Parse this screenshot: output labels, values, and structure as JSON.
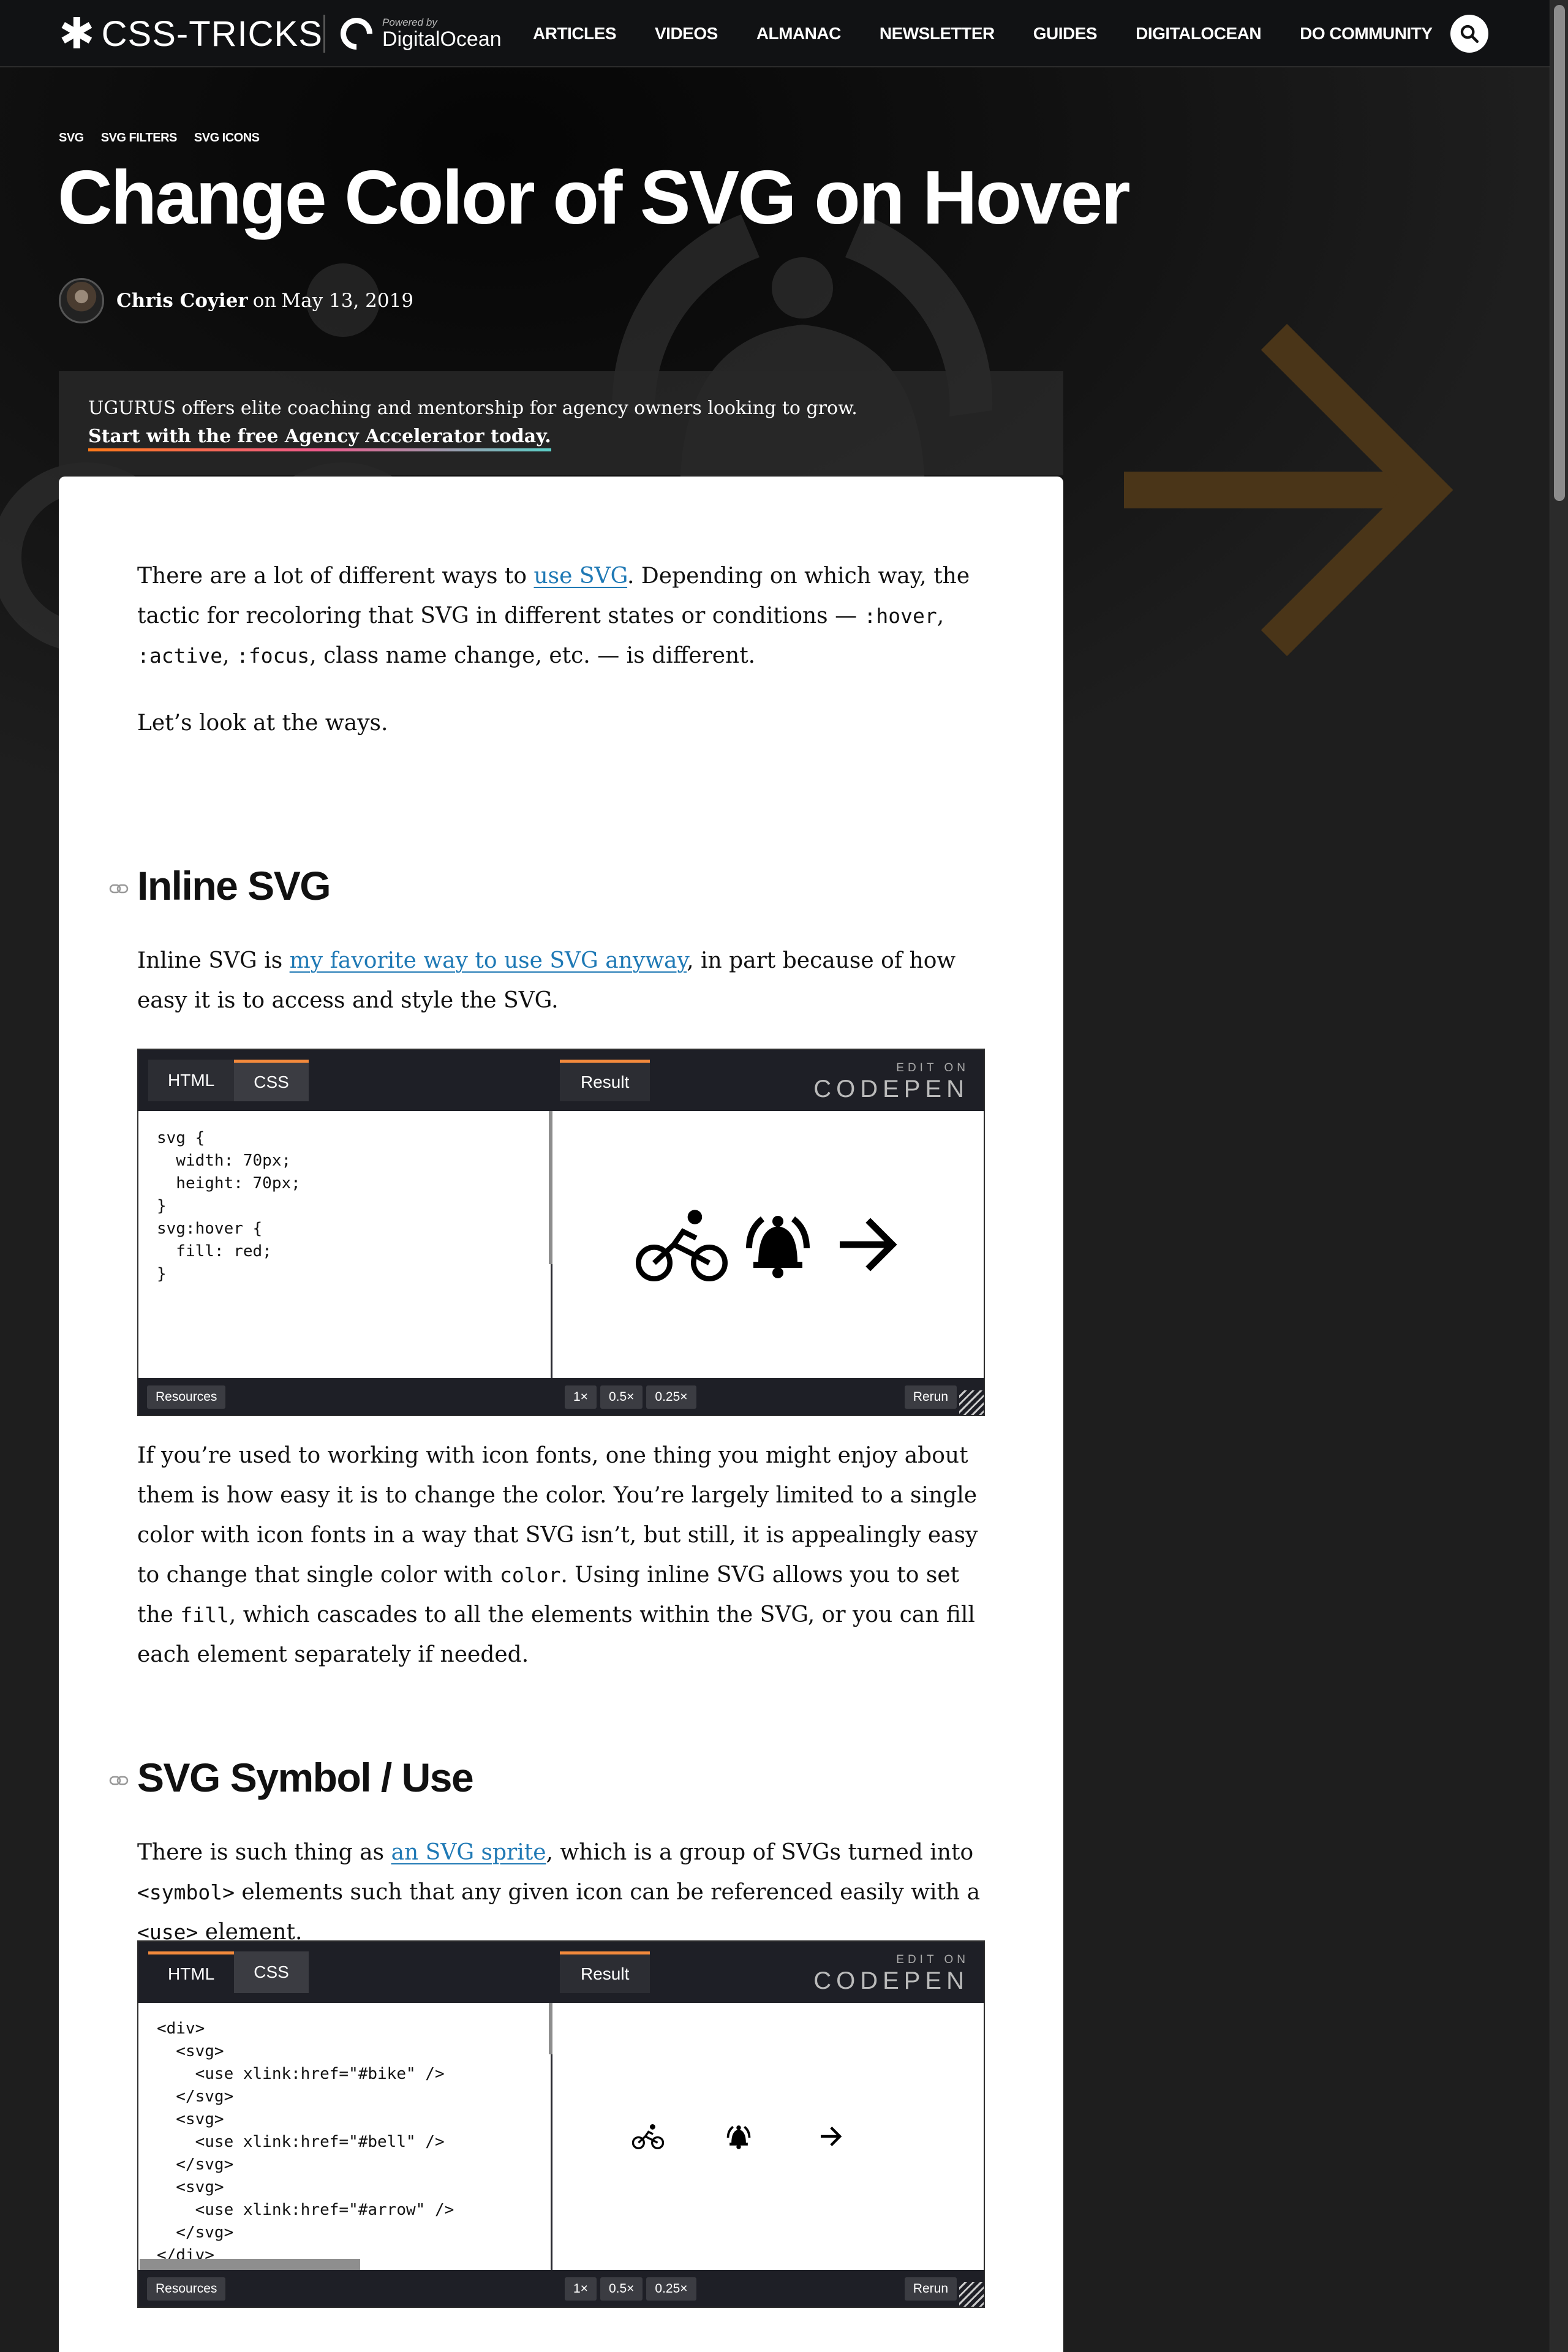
{
  "header": {
    "logo_text": "CSS-TRICKS",
    "powered_by": "Powered by",
    "sponsor": "DigitalOcean",
    "nav": [
      "ARTICLES",
      "VIDEOS",
      "ALMANAC",
      "NEWSLETTER",
      "GUIDES",
      "DIGITALOCEAN",
      "DO COMMUNITY"
    ],
    "search_icon": "search-icon"
  },
  "tags": [
    "SVG",
    "SVG FILTERS",
    "SVG ICONS"
  ],
  "title": "Change Color of SVG on Hover",
  "byline": {
    "author": "Chris Coyier",
    "on": "on",
    "date": "May 13, 2019"
  },
  "promo": {
    "text": "UGURUS offers elite coaching and mentorship for agency owners looking to grow.",
    "link": "Start with the free Agency Accelerator today."
  },
  "intro": {
    "p1_a": "There are a lot of different ways to ",
    "p1_link": "use SVG",
    "p1_b": ". Depending on which way, the tactic for recoloring that SVG in different states or conditions — ",
    "p1_code1": ":hover",
    "p1_sep1": ", ",
    "p1_code2": ":active",
    "p1_sep2": ", ",
    "p1_code3": ":focus",
    "p1_c": ", class name change, etc. — is different.",
    "p2": "Let’s look at the ways."
  },
  "section1": {
    "heading": "Inline SVG",
    "p_a": "Inline SVG is ",
    "p_link": "my favorite way to use SVG anyway",
    "p_b": ", in part because of how easy it is to access and style the SVG.",
    "pen": {
      "tabs": [
        "HTML",
        "CSS"
      ],
      "active_tab": "CSS",
      "result_label": "Result",
      "edit_on": "EDIT ON",
      "codepen": "CODEPEN",
      "code": [
        "svg {",
        "  width: 70px;",
        "  height: 70px;",
        "}",
        "svg:hover {",
        "  fill: red;",
        "}"
      ],
      "icons": [
        "bike-icon",
        "bell-icon",
        "arrow-right-icon"
      ],
      "footer": {
        "resources": "Resources",
        "zooms": [
          "1×",
          "0.5×",
          "0.25×"
        ],
        "rerun": "Rerun"
      }
    },
    "after_a": "If you’re used to working with icon fonts, one thing you might enjoy about them is how easy it is to change the color. You’re largely limited to a single color with icon fonts in a way that SVG isn’t, but still, it is appealingly easy to change that single color with ",
    "after_code1": "color",
    "after_b": ". Using inline SVG allows you to set the ",
    "after_code2": "fill",
    "after_c": ", which cascades to all the elements within the SVG, or you can fill each element separately if needed."
  },
  "section2": {
    "heading": "SVG Symbol / Use",
    "p_a": "There is such thing as ",
    "p_link": "an SVG sprite",
    "p_b": ", which is a group of SVGs turned into ",
    "p_code1": "<symbol>",
    "p_c": " elements such that any given icon can be referenced easily with a ",
    "p_code2": "<use>",
    "p_d": " element.",
    "pen": {
      "tabs": [
        "HTML",
        "CSS"
      ],
      "active_tab": "HTML",
      "result_label": "Result",
      "edit_on": "EDIT ON",
      "codepen": "CODEPEN",
      "code": [
        "<div>",
        "  <svg>",
        "    <use xlink:href=\"#bike\" />",
        "  </svg>",
        "  <svg>",
        "    <use xlink:href=\"#bell\" />",
        "  </svg>",
        "  <svg>",
        "    <use xlink:href=\"#arrow\" />",
        "  </svg>",
        "</div>"
      ],
      "icons": [
        "bike-icon",
        "bell-icon",
        "arrow-right-icon"
      ],
      "footer": {
        "resources": "Resources",
        "zooms": [
          "1×",
          "0.5×",
          "0.25×"
        ],
        "rerun": "Rerun"
      }
    }
  },
  "colors": {
    "accent": "#f48a3c",
    "link": "#1f79b5",
    "hero_arrow": "#4a3518"
  }
}
